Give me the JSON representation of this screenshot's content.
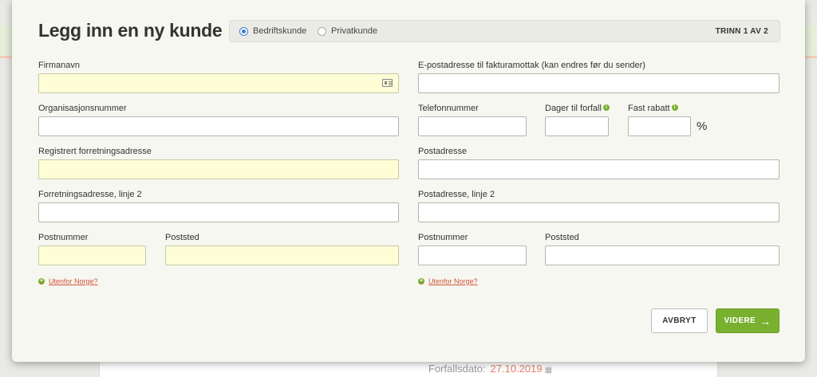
{
  "dialog": {
    "title": "Legg inn en ny kunde",
    "customer_type": {
      "options": [
        {
          "label": "Bedriftskunde",
          "selected": true
        },
        {
          "label": "Privatkunde",
          "selected": false
        }
      ],
      "step": "TRINN 1 AV 2"
    }
  },
  "left": {
    "company_name": {
      "label": "Firmanavn",
      "value": "",
      "required": true
    },
    "org_number": {
      "label": "Organisasjonsnummer",
      "value": ""
    },
    "business_address": {
      "label": "Registrert forretningsadresse",
      "value": "",
      "required": true
    },
    "business_address_2": {
      "label": "Forretningsadresse, linje 2",
      "value": ""
    },
    "postal_code": {
      "label": "Postnummer",
      "value": "",
      "required": true
    },
    "postal_city": {
      "label": "Poststed",
      "value": "",
      "required": true
    },
    "outside_norway": "Utenfor Norge?"
  },
  "right": {
    "invoice_email": {
      "label": "E-postadresse til fakturamottak (kan endres før du sender)",
      "value": ""
    },
    "phone": {
      "label": "Telefonnummer",
      "value": ""
    },
    "due_days": {
      "label": "Dager til forfall",
      "value": ""
    },
    "fixed_discount": {
      "label": "Fast rabatt",
      "value": "",
      "unit": "%"
    },
    "postal_address": {
      "label": "Postadresse",
      "value": ""
    },
    "postal_address_2": {
      "label": "Postadresse, linje 2",
      "value": ""
    },
    "postal_code": {
      "label": "Postnummer",
      "value": ""
    },
    "postal_city": {
      "label": "Poststed",
      "value": ""
    },
    "outside_norway": "Utenfor Norge?"
  },
  "actions": {
    "cancel": "AVBRYT",
    "next": "VIDERE",
    "next_icon": "arrow-right-icon"
  },
  "background": {
    "due_date_label": "Forfallsdato:",
    "due_date_value": "27.10.2019"
  },
  "colors": {
    "accent_green": "#7ab030",
    "link_red": "#d0553a",
    "required_field": "#fdfdd6",
    "radio_blue": "#3a7bd5"
  }
}
